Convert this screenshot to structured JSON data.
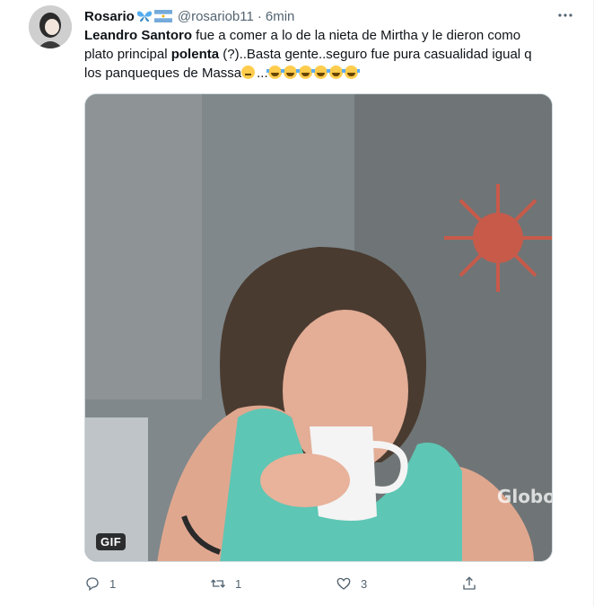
{
  "user": {
    "display_name": "Rosario",
    "handle": "@rosariob11",
    "separator": "·",
    "time": "6min"
  },
  "tweet": {
    "parts": [
      {
        "text": "Leandro Santoro",
        "bold": true
      },
      {
        "text": " fue a comer a lo de la nieta de Mirtha y le dieron como plato principal ",
        "bold": false
      },
      {
        "text": "polenta",
        "bold": true
      },
      {
        "text": " (?)..Basta gente..seguro fue pura casualidad igual q los panqueques de Massa",
        "bold": false
      },
      {
        "text": "...",
        "bold": false
      }
    ],
    "emojis_after_massa": "thinking-face",
    "laugh_emoji_count": 6
  },
  "media": {
    "badge": "GIF",
    "watermark": "Globo"
  },
  "actions": {
    "reply_count": "1",
    "retweet_count": "1",
    "like_count": "3"
  },
  "colors": {
    "text": "#0f1419",
    "secondary": "#536471",
    "border": "#cfd9de"
  }
}
